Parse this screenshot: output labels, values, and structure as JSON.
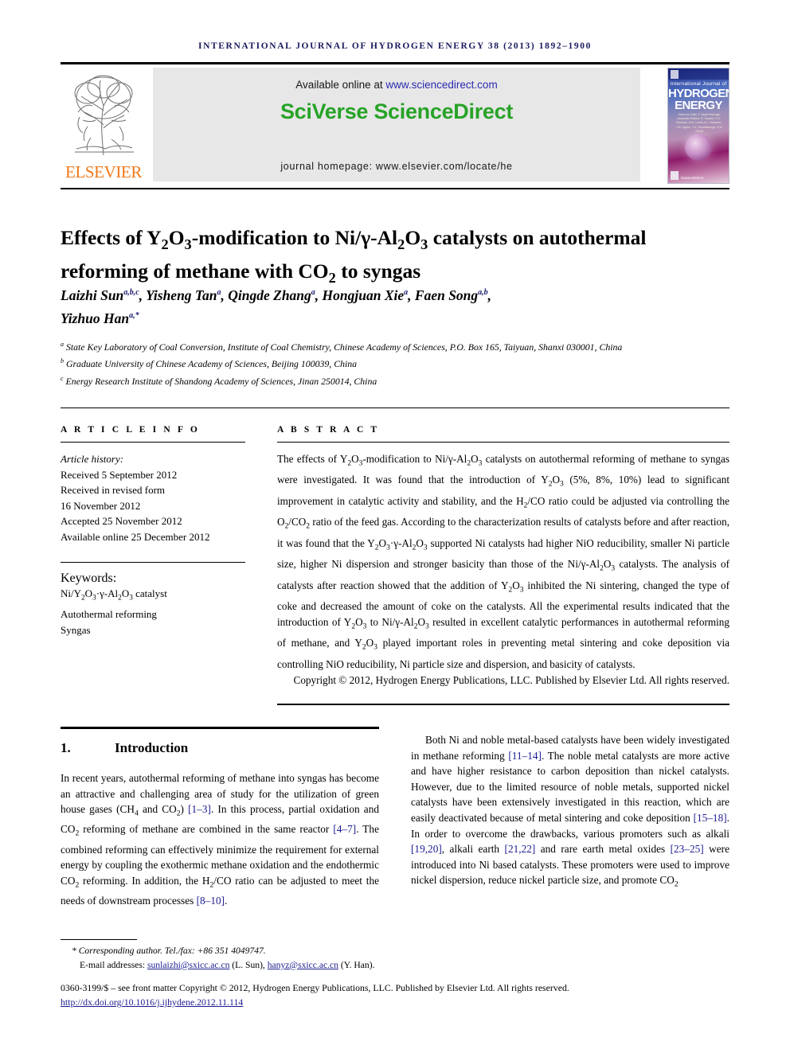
{
  "running_head": "International Journal of Hydrogen Energy 38 (2013) 1892–1900",
  "masthead": {
    "publisher_name": "ELSEVIER",
    "available_prefix": "Available online at ",
    "sciencedirect_url": "www.sciencedirect.com",
    "brand": "SciVerse ScienceDirect",
    "journal_homepage": "journal homepage: www.elsevier.com/locate/he",
    "cover": {
      "line_small": "International Journal of",
      "line_hydrogen": "HYDROGEN",
      "line_energy": "ENERGY",
      "editors": "Editor-in-Chief: T. Nejat Veziroglu   Associate Editors: R. Mackie, D.C. Branhan, M.A. Lewis, A.L. Marsden, J.M. Ogden, T.A. Semelsberger, S.A. Sherif",
      "sd_mark": "ScienceDirect"
    }
  },
  "title": "Effects of Y2O3-modification to Ni/γ-Al2O3 catalysts on autothermal reforming of methane with CO2 to syngas",
  "authors": [
    {
      "name": "Laizhi Sun",
      "sup": "a,b,c"
    },
    {
      "name": "Yisheng Tan",
      "sup": "a"
    },
    {
      "name": "Qingde Zhang",
      "sup": "a"
    },
    {
      "name": "Hongjuan Xie",
      "sup": "a"
    },
    {
      "name": "Faen Song",
      "sup": "a,b"
    },
    {
      "name": "Yizhuo Han",
      "sup": "a,*"
    }
  ],
  "affiliations": [
    {
      "label": "a",
      "text": "State Key Laboratory of Coal Conversion, Institute of Coal Chemistry, Chinese Academy of Sciences, P.O. Box 165, Taiyuan, Shanxi 030001, China"
    },
    {
      "label": "b",
      "text": "Graduate University of Chinese Academy of Sciences, Beijing 100039, China"
    },
    {
      "label": "c",
      "text": "Energy Research Institute of Shandong Academy of Sciences, Jinan 250014, China"
    }
  ],
  "article_info": {
    "heading": "A R T I C L E  I N F O",
    "history_label": "Article history:",
    "history": [
      "Received 5 September 2012",
      "Received in revised form",
      "16 November 2012",
      "Accepted 25 November 2012",
      "Available online 25 December 2012"
    ],
    "keywords_label": "Keywords:",
    "keywords": [
      "Ni/Y2O3·γ-Al2O3 catalyst",
      "Autothermal reforming",
      "Syngas"
    ]
  },
  "abstract": {
    "heading": "A B S T R A C T",
    "body": "The effects of Y2O3-modification to Ni/γ-Al2O3 catalysts on autothermal reforming of methane to syngas were investigated. It was found that the introduction of Y2O3 (5%, 8%, 10%) lead to significant improvement in catalytic activity and stability, and the H2/CO ratio could be adjusted via controlling the O2/CO2 ratio of the feed gas. According to the characterization results of catalysts before and after reaction, it was found that the Y2O3·γ-Al2O3 supported Ni catalysts had higher NiO reducibility, smaller Ni particle size, higher Ni dispersion and stronger basicity than those of the Ni/γ-Al2O3 catalysts. The analysis of catalysts after reaction showed that the addition of Y2O3 inhibited the Ni sintering, changed the type of coke and decreased the amount of coke on the catalysts. All the experimental results indicated that the introduction of Y2O3 to Ni/γ-Al2O3 resulted in excellent catalytic performances in autothermal reforming of methane, and Y2O3 played important roles in preventing metal sintering and coke deposition via controlling NiO reducibility, Ni particle size and dispersion, and basicity of catalysts.",
    "copyright": "Copyright © 2012, Hydrogen Energy Publications, LLC. Published by Elsevier Ltd. All rights reserved."
  },
  "section": {
    "number": "1.",
    "heading": "Introduction",
    "left_paragraph": "In recent years, autothermal reforming of methane into syngas has become an attractive and challenging area of study for the utilization of green house gases (CH4 and CO2) [1–3]. In this process, partial oxidation and CO2 reforming of methane are combined in the same reactor [4–7]. The combined reforming can effectively minimize the requirement for external energy by coupling the exothermic methane oxidation and the endothermic CO2 reforming. In addition, the H2/CO ratio can be adjusted to meet the needs of downstream processes [8–10].",
    "right_paragraph": "Both Ni and noble metal-based catalysts have been widely investigated in methane reforming [11–14]. The noble metal catalysts are more active and have higher resistance to carbon deposition than nickel catalysts. However, due to the limited resource of noble metals, supported nickel catalysts have been extensively investigated in this reaction, which are easily deactivated because of metal sintering and coke deposition [15–18]. In order to overcome the drawbacks, various promoters such as alkali [19,20], alkali earth [21,22] and rare earth metal oxides [23–25] were introduced into Ni based catalysts. These promoters were used to improve nickel dispersion, reduce nickel particle size, and promote CO2"
  },
  "footnotes": {
    "corresponding": "* Corresponding author. Tel./fax: +86 351 4049747.",
    "email_label": "E-mail addresses: ",
    "email1": "sunlaizhi@sxicc.ac.cn",
    "email1_owner": " (L. Sun), ",
    "email2": "hanyz@sxicc.ac.cn",
    "email2_owner": " (Y. Han).",
    "issn_line": "0360-3199/$ – see front matter Copyright © 2012, Hydrogen Energy Publications, LLC. Published by Elsevier Ltd. All rights reserved.",
    "doi": "http://dx.doi.org/10.1016/j.ijhydene.2012.11.114"
  },
  "colors": {
    "running_head": "#1a1a5e",
    "sciverse_green": "#27a327",
    "elsevier_orange": "#F07818",
    "link_blue": "#1b1b8f"
  }
}
